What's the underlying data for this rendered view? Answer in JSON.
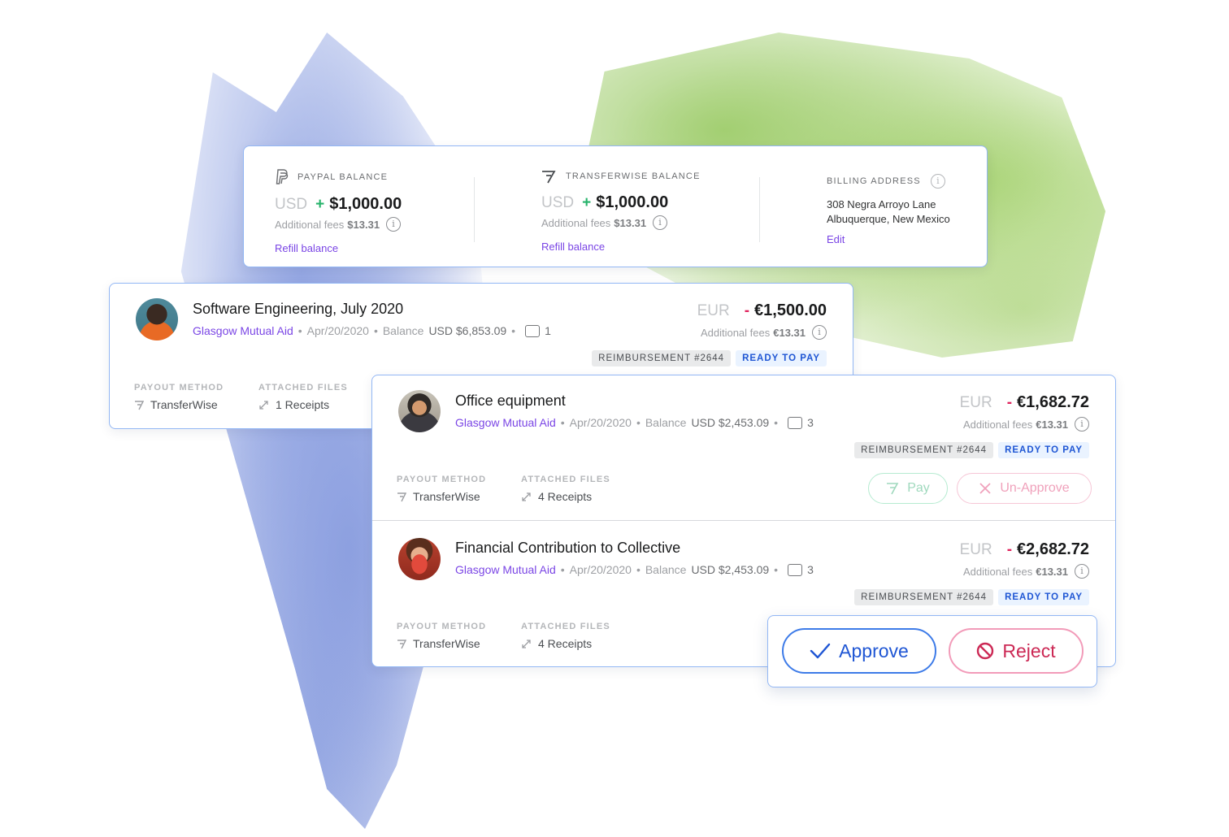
{
  "balances": {
    "paypal": {
      "label": "PAYPAL BALANCE",
      "currency": "USD",
      "sign": "+",
      "amount": "$1,000.00",
      "fees_label": "Additional fees",
      "fees_value": "$13.31",
      "refill": "Refill balance"
    },
    "transferwise": {
      "label": "TRANSFERWISE BALANCE",
      "currency": "USD",
      "sign": "+",
      "amount": "$1,000.00",
      "fees_label": "Additional fees",
      "fees_value": "$13.31",
      "refill": "Refill balance"
    },
    "billing": {
      "label": "BILLING ADDRESS",
      "line1": "308 Negra Arroyo Lane",
      "line2": "Albuquerque, New Mexico",
      "edit": "Edit"
    }
  },
  "expenses": [
    {
      "title": "Software Engineering, July 2020",
      "collective": "Glasgow Mutual Aid",
      "date": "Apr/20/2020",
      "balance_label": "Balance",
      "balance": "USD $6,853.09",
      "comments": "1",
      "currency": "EUR",
      "sign": "-",
      "amount": "€1,500.00",
      "fees_label": "Additional fees",
      "fees_value": "€13.31",
      "tag": "REIMBURSEMENT #2644",
      "status": "READY TO PAY",
      "payout_label": "PAYOUT METHOD",
      "payout_value": "TransferWise",
      "files_label": "ATTACHED FILES",
      "files_value": "1 Receipts"
    },
    {
      "title": "Office equipment",
      "collective": "Glasgow Mutual Aid",
      "date": "Apr/20/2020",
      "balance_label": "Balance",
      "balance": "USD $2,453.09",
      "comments": "3",
      "currency": "EUR",
      "sign": "-",
      "amount": "€1,682.72",
      "fees_label": "Additional fees",
      "fees_value": "€13.31",
      "tag": "REIMBURSEMENT #2644",
      "status": "READY TO PAY",
      "payout_label": "PAYOUT METHOD",
      "payout_value": "TransferWise",
      "files_label": "ATTACHED FILES",
      "files_value": "4 Receipts",
      "pay": "Pay",
      "unapprove": "Un-Approve"
    },
    {
      "title": "Financial Contribution to Collective",
      "collective": "Glasgow Mutual Aid",
      "date": "Apr/20/2020",
      "balance_label": "Balance",
      "balance": "USD $2,453.09",
      "comments": "3",
      "currency": "EUR",
      "sign": "-",
      "amount": "€2,682.72",
      "fees_label": "Additional fees",
      "fees_value": "€13.31",
      "tag": "REIMBURSEMENT #2644",
      "status": "READY TO PAY",
      "payout_label": "PAYOUT METHOD",
      "payout_value": "TransferWise",
      "files_label": "ATTACHED FILES",
      "files_value": "4 Receipts"
    }
  ],
  "actions": {
    "approve": "Approve",
    "reject": "Reject"
  },
  "separator": "•",
  "colors": {
    "accent": "#7a45e5",
    "primary_blue": "#1f56d4",
    "positive": "#27b36b",
    "negative": "#e0245e",
    "border": "#93b7f4"
  },
  "icons": [
    "paypal-icon",
    "transferwise-icon",
    "info-icon",
    "comment-icon",
    "attachment-icon",
    "check-icon",
    "ban-icon",
    "close-icon"
  ]
}
